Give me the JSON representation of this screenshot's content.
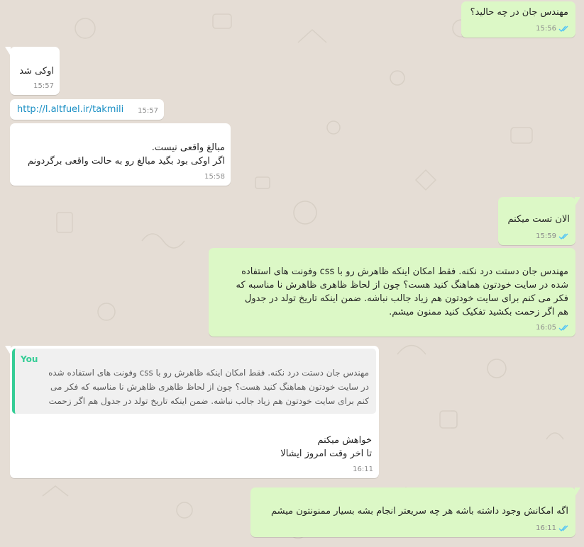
{
  "theme": {
    "wallpaper": "#e5ddd5",
    "incoming_bubble": "#ffffff",
    "outgoing_bubble": "#dcf8c6",
    "tick_read": "#4fc3f7",
    "link": "#1a8fc4",
    "quote_accent": "#35cd96"
  },
  "messages": [
    {
      "direction": "outgoing",
      "text": "مهندس جان در چه حالید؟",
      "time": "15:56",
      "status_icon": "double-check-icon"
    },
    {
      "direction": "incoming",
      "text": "اوکی شد",
      "time": "15:57"
    },
    {
      "direction": "incoming",
      "text": "http://l.altfuel.ir/takmili",
      "time": "15:57",
      "is_link": true
    },
    {
      "direction": "incoming",
      "text": "مبالغ واقعی نیست.\nاگر اوکی بود بگید مبالغ رو به حالت واقعی برگردونم",
      "time": "15:58"
    },
    {
      "direction": "outgoing",
      "text": "الان تست میکنم",
      "time": "15:59",
      "status_icon": "double-check-icon"
    },
    {
      "direction": "outgoing",
      "text": "مهندس جان دستت درد نکنه. فقط امکان اینکه ظاهرش رو با css وفونت های استفاده\nشده در سایت خودتون هماهنگ کنید هست؟ چون از لحاظ ظاهری ظاهرش نا مناسبه که\nفکر می کنم برای سایت خودتون هم زیاد جالب نباشه. ضمن اینکه تاریخ تولد در جدول\nهم اگر زحمت بکشید تفکیک کنید ممنون میشم.",
      "time": "16:05",
      "status_icon": "double-check-icon"
    },
    {
      "direction": "incoming",
      "quote_author": "You",
      "quote_text": "مهندس جان دستت درد نکنه. فقط امکان اینکه ظاهرش رو با css وفونت های استفاده شده\nدر سایت خودتون هماهنگ کنید هست؟ چون از لحاظ ظاهری ظاهرش نا مناسبه که فکر می\nکنم برای سایت خودتون هم زیاد جالب نباشه. ضمن اینکه تاریخ تولد در جدول هم اگر زحمت",
      "text": "خواهش میکنم\nتا اخر وقت امروز ایشالا",
      "time": "16:11"
    },
    {
      "direction": "outgoing",
      "text": "اگه امکانش وجود داشته باشه هر چه سریعتر انجام بشه بسیار ممنونتون میشم",
      "time": "16:11",
      "status_icon": "double-check-icon"
    }
  ]
}
